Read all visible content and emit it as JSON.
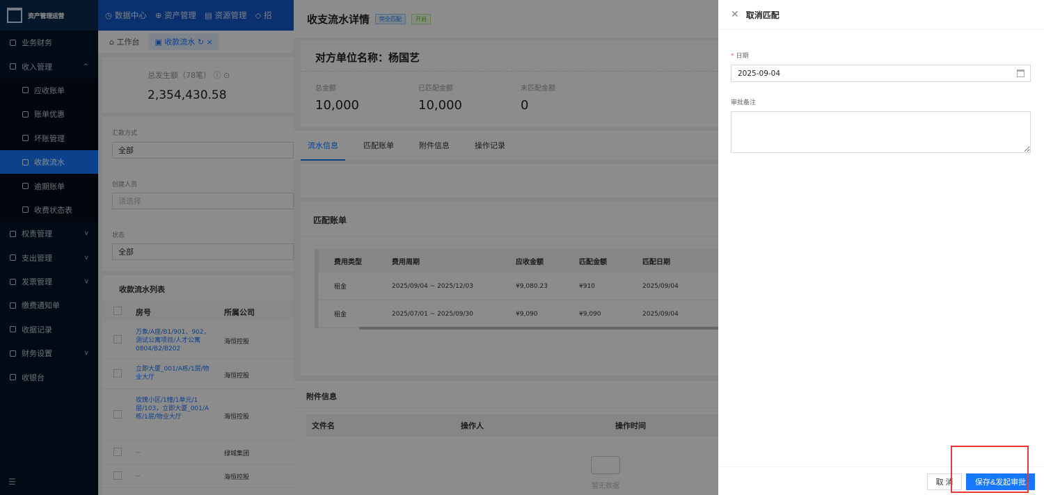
{
  "app": {
    "name": "资产管理运营"
  },
  "topnav": [
    "数据中心",
    "资产管理",
    "资源管理",
    "招"
  ],
  "tabs": [
    {
      "label": "工作台"
    },
    {
      "label": "收款流水"
    }
  ],
  "sidebar": {
    "items": [
      {
        "label": "业务财务",
        "level": 0
      },
      {
        "label": "收入管理",
        "level": 0,
        "arrow": "^"
      },
      {
        "label": "应收账单",
        "level": 1
      },
      {
        "label": "账单优惠",
        "level": 1
      },
      {
        "label": "坏账管理",
        "level": 1
      },
      {
        "label": "收款流水",
        "level": 1,
        "active": true
      },
      {
        "label": "逾期账单",
        "level": 1
      },
      {
        "label": "收费状态表",
        "level": 1
      },
      {
        "label": "权责管理",
        "level": 0,
        "arrow": "v"
      },
      {
        "label": "支出管理",
        "level": 0,
        "arrow": "v"
      },
      {
        "label": "发票管理",
        "level": 0,
        "arrow": "v"
      },
      {
        "label": "缴费通知单",
        "level": 0
      },
      {
        "label": "收据记录",
        "level": 0
      },
      {
        "label": "财务设置",
        "level": 0,
        "arrow": "v"
      },
      {
        "label": "收银台",
        "level": 0
      }
    ]
  },
  "background": {
    "total_label": "总发生额（78笔）",
    "total_value": "2,354,430.58",
    "filters": [
      {
        "label": "汇款方式",
        "value": "全部",
        "placeholder": false
      },
      {
        "label": "创建人员",
        "value": "请选择",
        "placeholder": true
      },
      {
        "label": "状态",
        "value": "全部",
        "placeholder": false
      }
    ],
    "list_title": "收款流水列表",
    "columns": [
      "房号",
      "所属公司"
    ],
    "rows": [
      {
        "room": "万象/A座/B1/901、902，测试公寓项目/人才公寓0804/B2/B202",
        "company": "海恒控股"
      },
      {
        "room": "立即大厦_001/A栋/1层/物业大厅",
        "company": "海恒控股"
      },
      {
        "room": "玫瑰小区/1幢/1单元/1层/103，立即大厦_001/A栋/1层/物业大厅",
        "company": "海恒控股"
      },
      {
        "room": "--",
        "company": "绿城集团"
      },
      {
        "room": "--",
        "company": "海恒控股"
      }
    ]
  },
  "detail": {
    "title": "收支流水详情",
    "tag_match": "完全匹配",
    "tag_status": "开启",
    "party_label": "对方单位名称：",
    "party_value": "杨国艺",
    "amounts": [
      {
        "label": "总金额",
        "value": "10,000"
      },
      {
        "label": "已匹配金额",
        "value": "10,000"
      },
      {
        "label": "未匹配金额",
        "value": "0"
      }
    ],
    "tabs": [
      {
        "label": "流水信息",
        "active": true
      },
      {
        "label": "匹配账单"
      },
      {
        "label": "附件信息"
      },
      {
        "label": "操作记录"
      }
    ],
    "match_title": "匹配账单",
    "match_columns": [
      "费用类型",
      "费用周期",
      "应收金额",
      "匹配金额",
      "匹配日期"
    ],
    "match_rows": [
      [
        "租金",
        "2025/09/04 ~ 2025/12/03",
        "¥9,080.23",
        "¥910",
        "2025/09/04"
      ],
      [
        "租金",
        "2025/07/01 ~ 2025/09/30",
        "¥9,090",
        "¥9,090",
        "2025/09/04"
      ]
    ],
    "attach_title": "附件信息",
    "attach_columns": [
      "文件名",
      "操作人",
      "操作时间"
    ],
    "empty_text": "暂无数据"
  },
  "drawer": {
    "title": "取消匹配",
    "date_label": "日期",
    "date_value": "2025-09-04",
    "remark_label": "审批备注",
    "remark_value": "",
    "cancel_label": "取 消",
    "save_label": "保存&发起审批"
  },
  "colors": {
    "primary": "#1677ff",
    "highlight": "#e53935",
    "sidebar": "#001529"
  }
}
